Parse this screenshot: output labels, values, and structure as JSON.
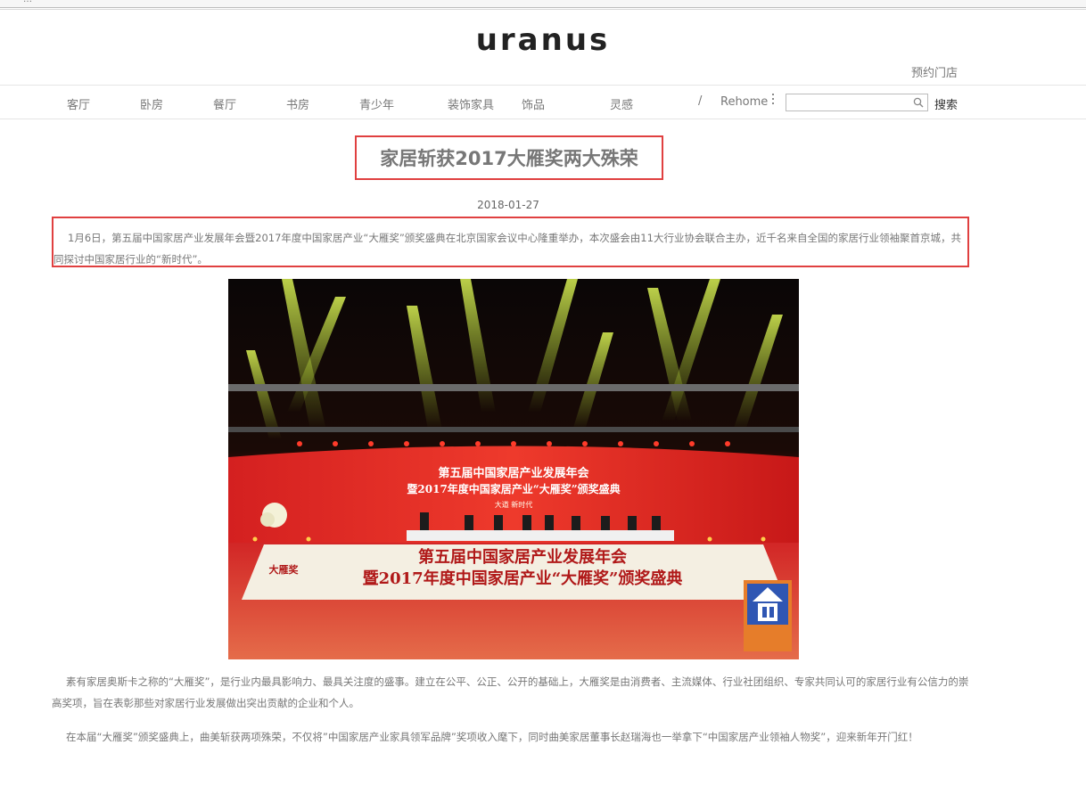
{
  "browser": {
    "fragment": "…"
  },
  "header": {
    "logo": "uranus",
    "store_link": "预约门店"
  },
  "nav": {
    "items": [
      "客厅",
      "卧房",
      "餐厅",
      "书房",
      "青少年",
      "装饰家具",
      "饰品",
      "灵感"
    ],
    "separator": "/",
    "rehome": "Rehome",
    "search_placeholder": "",
    "search_button": "搜索"
  },
  "article": {
    "title": "家居斩获2017大雁奖两大殊荣",
    "date": "2018-01-27",
    "intro": "1月6日，第五届中国家居产业发展年会暨2017年度中国家居产业“大雁奖”颁奖盛典在北京国家会议中心隆重举办，本次盛会由11大行业协会联合主办，近千名来自全国的家居行业领袖聚首京城，共同探讨中国家居行业的“新时代”。",
    "paragraph2": "素有家居奥斯卡之称的“大雁奖”，是行业内最具影响力、最具关注度的盛事。建立在公平、公正、公开的基础上，大雁奖是由消费者、主流媒体、行业社团组织、专家共同认可的家居行业有公信力的崇高奖项，旨在表彰那些对家居行业发展做出突出贡献的企业和个人。",
    "paragraph3": "在本届“大雁奖”颁奖盛典上，曲美斩获两项殊荣，不仅将”中国家居产业家具领军品牌”奖项收入麾下，同时曲美家居董事长赵瑞海也一举拿下“中国家居产业领袖人物奖”，迎来新年开门红！"
  },
  "photo": {
    "backdrop_line1": "第五届中国家居产业发展年会",
    "backdrop_line2": "暨2017年度中国家居产业“大雁奖”颁奖盛典",
    "backdrop_line3": "大道 新时代",
    "stage_line1": "第五届中国家居产业发展年会",
    "stage_line2": "暨2017年度中国家居产业“大雁奖”颁奖盛典",
    "logo_text": "大雁奖"
  },
  "colors": {
    "highlight": "#e04040",
    "text": "#777777"
  }
}
